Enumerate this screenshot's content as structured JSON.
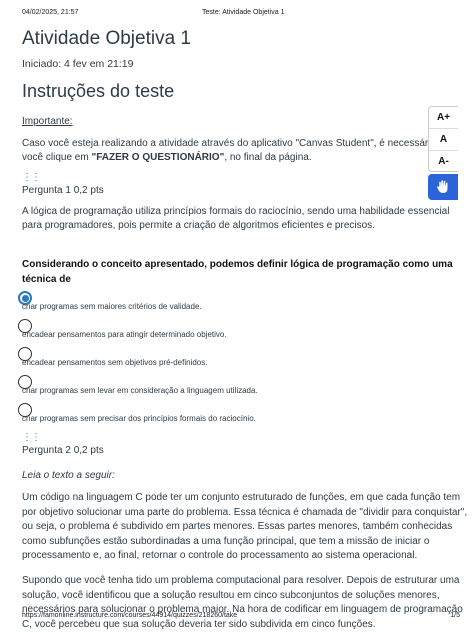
{
  "print_header": {
    "date": "04/02/2025, 21:57",
    "title": "Teste: Atividade Objetiva 1"
  },
  "print_footer": {
    "url": "https://famonline.instructure.com/courses/44914/quizzes/218260/take",
    "page": "1/5"
  },
  "quiz": {
    "title": "Atividade Objetiva 1",
    "started": "Iniciado: 4 fev em 21:19",
    "instructions_heading": "Instruções do teste",
    "important": "Importante:",
    "notice_line1": "Caso você esteja realizando a atividade através do aplicativo \"Canvas Student\", é necessário que",
    "notice_line2_pre": "você clique em ",
    "notice_line2_bold": "\"FAZER O QUESTIONÁRIO\"",
    "notice_line2_post": ", no final da página."
  },
  "drag_icon": "⋮⋮",
  "question1": {
    "header": "Pergunta 1 0,2 pts",
    "text_line1": "A lógica de programação utiliza princípios formais do raciocínio, sendo uma habilidade essencial",
    "text_line2": "para programadores, pois permite a criação de algoritmos eficientes e precisos.",
    "prompt_line1": "Considerando o conceito apresentado, podemos definir lógica de programação como uma",
    "prompt_line2": "técnica de",
    "answers": [
      {
        "label": "criar programas sem maiores critérios de validade.",
        "selected": true
      },
      {
        "label": "encadear pensamentos para atingir determinado objetivo.",
        "selected": false
      },
      {
        "label": "encadear pensamentos sem objetivos pré-definidos.",
        "selected": false
      },
      {
        "label": "criar programas sem levar em consideração a linguagem utilizada.",
        "selected": false
      },
      {
        "label": "criar programas sem precisar dos princípios formais do raciocínio.",
        "selected": false
      }
    ]
  },
  "question2": {
    "header": "Pergunta 2 0,2 pts",
    "reading": "Leia o texto a seguir:",
    "para1": [
      "Um código na linguagem C pode ter um conjunto estruturado de funções, em que cada função tem",
      "por objetivo solucionar uma parte do problema. Essa técnica é chamada de \"dividir para conquistar\",",
      "ou seja, o problema é subdivido em partes menores. Essas partes menores, também conhecidas",
      "como subfunções estão subordinadas a uma função principal, que tem a missão de iniciar o",
      "processamento e, ao final, retornar o controle do processamento ao sistema operacional."
    ],
    "para2": [
      "Supondo que você tenha tido um problema computacional para resolver. Depois de estruturar uma",
      "solução, você identificou que a solução resultou em cinco subconjuntos de soluções menores,",
      "necessários para solucionar o problema maior. Na hora de codificar em linguagem de programação",
      "C, você percebeu que sua solução deveria ter sido subdivida em cinco funções."
    ]
  },
  "accessibility": {
    "increase": "A+",
    "normal": "A",
    "decrease": "A-"
  },
  "colors": {
    "accent": "#2b7abc",
    "hand_button": "#2b64d9"
  }
}
